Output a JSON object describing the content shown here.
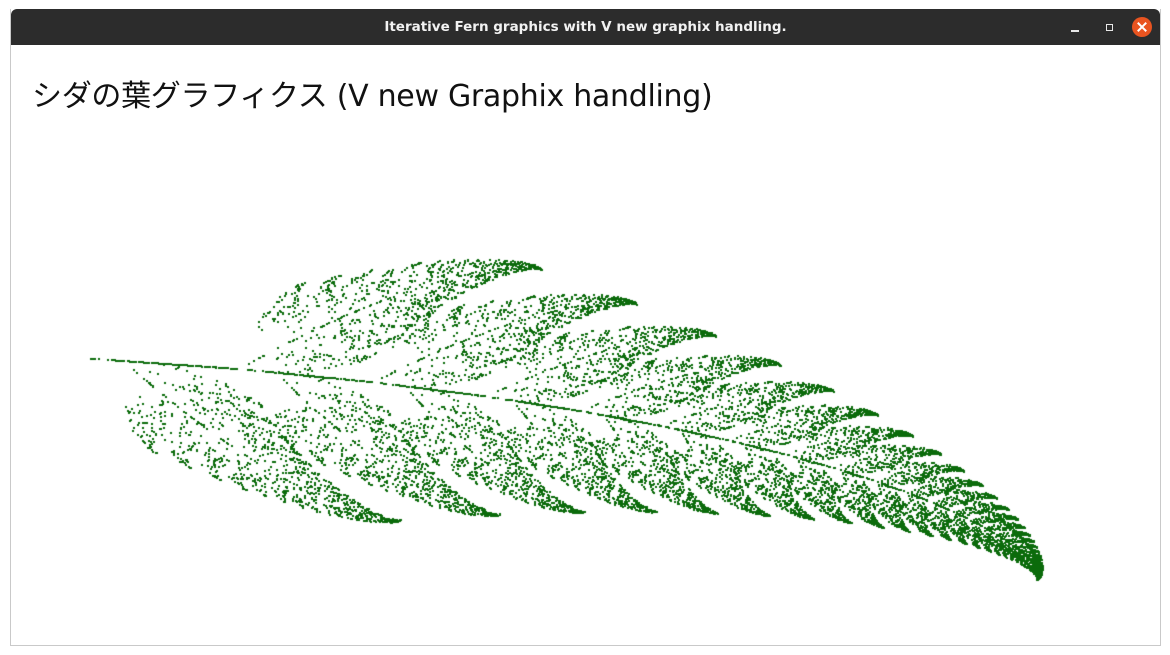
{
  "window": {
    "title": "Iterative Fern graphics with V new graphix handling."
  },
  "controls": {
    "minimize_icon": "minimize-icon",
    "maximize_icon": "maximize-icon",
    "close_icon": "close-icon",
    "close_color": "#e95420"
  },
  "canvas": {
    "heading": "シダの葉グラフィクス (V new Graphix handling)",
    "background_color": "#ffffff",
    "fern_color": "#0b6b0b"
  }
}
